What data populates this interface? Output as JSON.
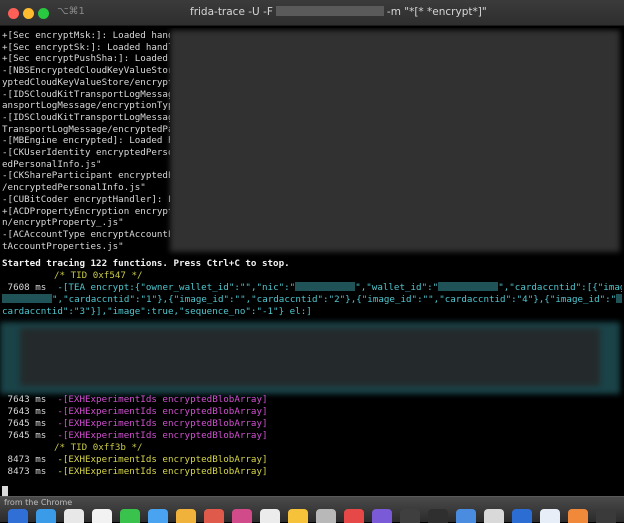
{
  "window": {
    "title_prefix": "frida-trace -U -F",
    "title_suffix": "-m \"*[* *encrypt*]\"",
    "shortcut": "⌥⌘1"
  },
  "terminal": {
    "loaded_lines": [
      "+[Sec encryptMsk:]: Loaded handler",
      "+[Sec encryptSk:]: Loaded handler",
      "+[Sec encryptPushSha:]: Loaded han",
      "-[NBSEncryptedCloudKeyValueStore e",
      "yptedCloudKeyValueStore/encryptPro",
      "-[IDSCloudKitTransportLogMessage e",
      "ansportLogMessage/encryptionType.j",
      "-[IDSCloudKitTransportLogMessage e",
      "TransportLogMessage/encryptedPaylo",
      "-[MBEngine encrypted]: Loaded hand",
      "-[CKUserIdentity encryptedPersonal",
      "edPersonalInfo.js\"",
      "-[CKShareParticipant encryptedPers",
      "/encryptedPersonalInfo.js\"",
      "-[CUBitCoder encryptHandler]: Load",
      "+[ACDPropertyEncryption encryptPro",
      "n/encryptProperty_.js\"",
      "-[ACAccountType encryptAccountProp",
      "tAccountProperties.js\""
    ],
    "started": "Started tracing 122 functions. Press Ctrl+C to stop.",
    "tid1": "/* TID 0xf547 */",
    "tea_time": " 7608 ms",
    "tea_l1_a": "-[TEA encrypt:{\"owner_wallet_id\":\"\",\"nic\":\"",
    "tea_l1_b": "\",\"wallet_id\":\"",
    "tea_l1_c": "\",\"cardaccntid\":[{\"image_id\":\"",
    "tea_l2_a": "\",\"cardaccntid\":\"1\"},{\"image_id\":\"\",\"cardaccntid\":\"2\"},{\"image_id\":\"\",\"cardaccntid\":\"4\"},{\"image_id\":\"",
    "tea_l3": "cardaccntid\":\"3\"}],\"image\":true,\"sequence_no\":\"-1\"} el:]",
    "exh_entries": [
      {
        "time": " 7643 ms",
        "call": "-[EXHExperimentIds encryptedBlobArray]"
      },
      {
        "time": " 7643 ms",
        "call": "-[EXHExperimentIds encryptedBlobArray]"
      },
      {
        "time": " 7645 ms",
        "call": "-[EXHExperimentIds encryptedBlobArray]"
      },
      {
        "time": " 7645 ms",
        "call": "-[EXHExperimentIds encryptedBlobArray]"
      }
    ],
    "tid2": "/* TID 0xff3b */",
    "exh_entries_2": [
      {
        "time": " 8473 ms",
        "call": "-[EXHExperimentIds encryptedBlobArray]"
      },
      {
        "time": " 8473 ms",
        "call": "-[EXHExperimentIds encryptedBlobArray]"
      }
    ]
  },
  "dock": {
    "caption": "from the Chrome"
  },
  "colors": {
    "background": "#000000",
    "text": "#d9d9d9",
    "cyan": "#4fc6cf",
    "magenta": "#d24fd2",
    "yellow": "#d6d64a"
  }
}
